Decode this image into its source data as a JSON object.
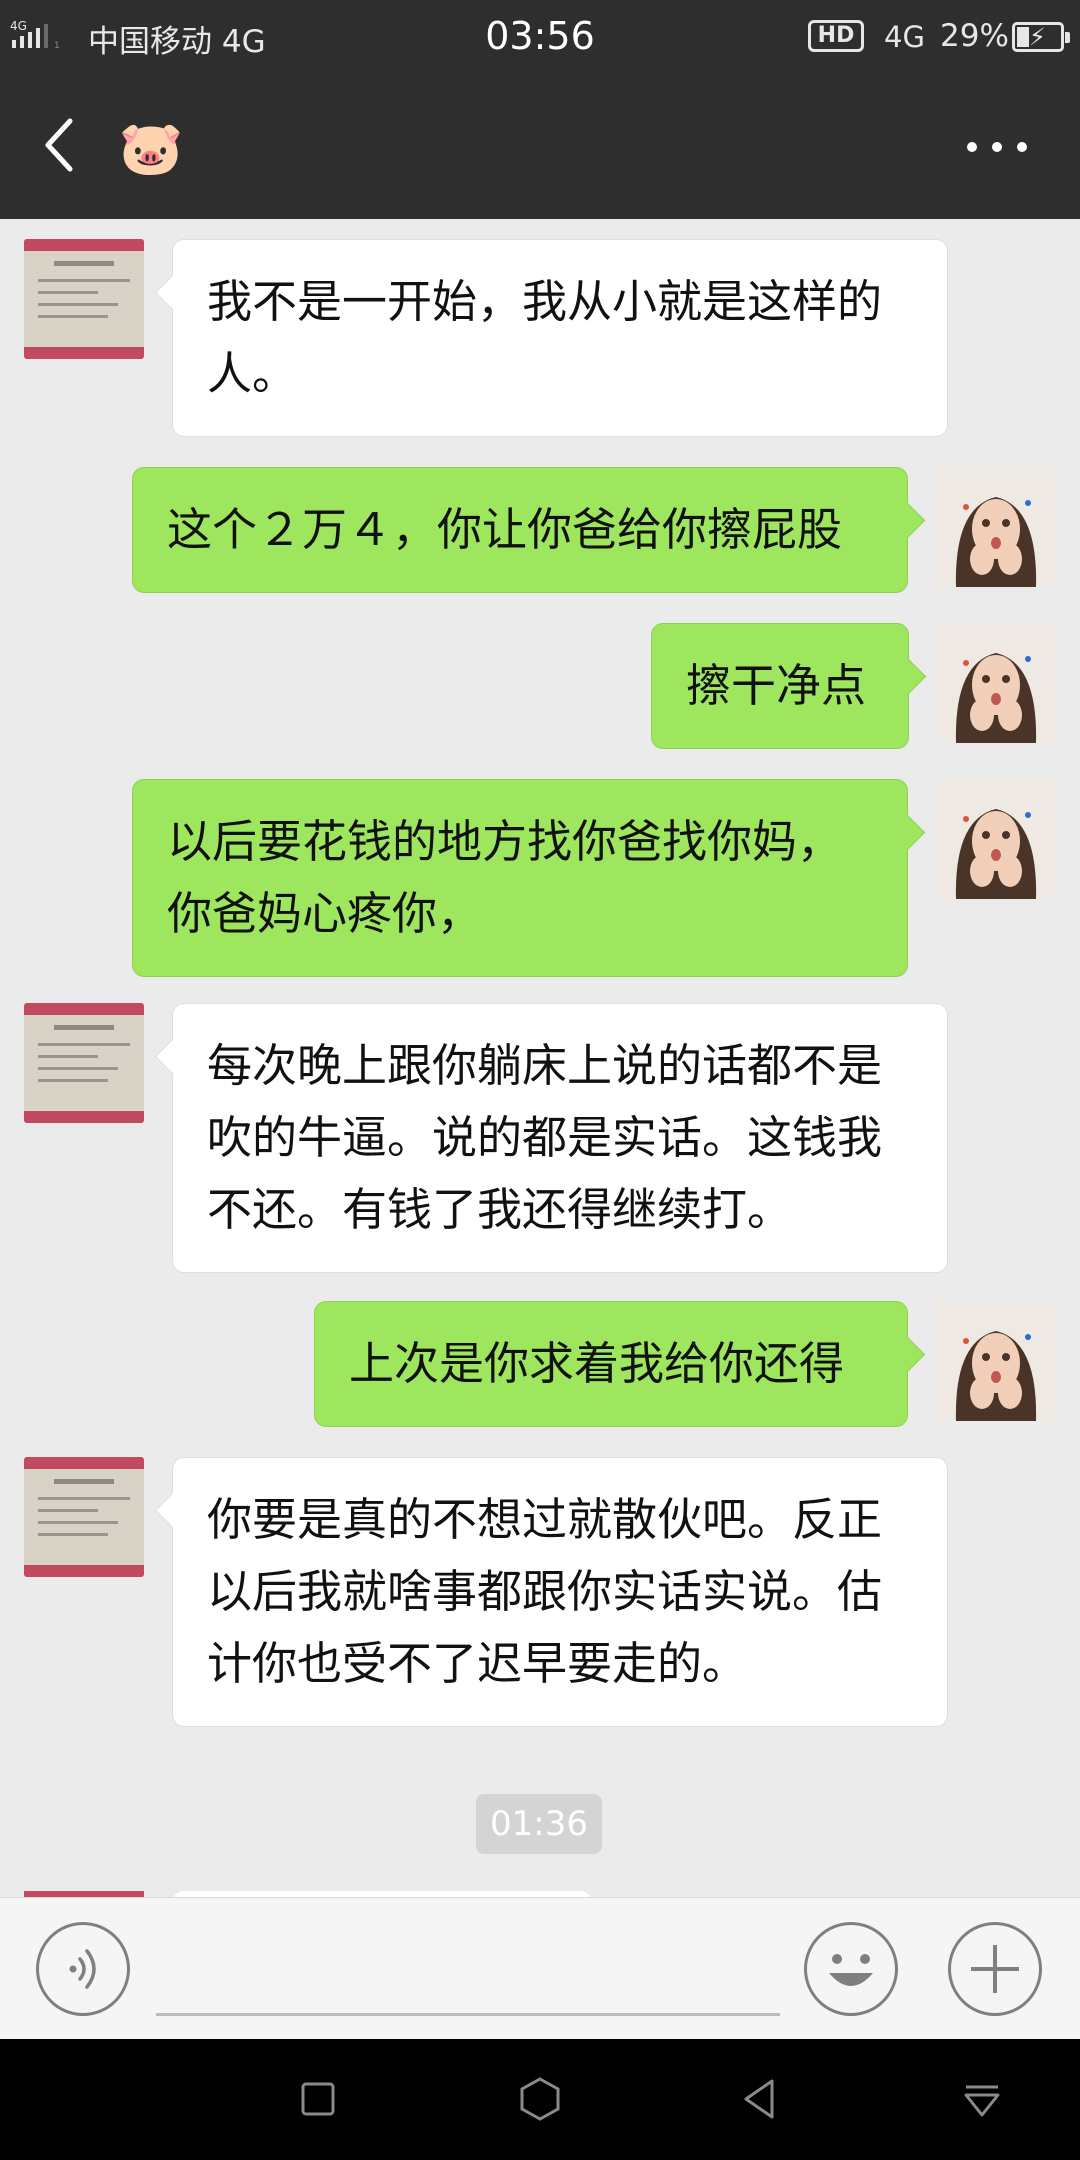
{
  "status_bar": {
    "network_small": "4G",
    "carrier": "中国移动 4G",
    "time": "03:56",
    "hd": "HD",
    "network": "4G",
    "battery": "29%",
    "battery_level": 0.29
  },
  "header": {
    "title_emoji": "🐷",
    "back_icon": "chevron-left-icon",
    "more_icon": "more-horizontal-icon"
  },
  "messages": [
    {
      "side": "in",
      "text": "我不是一开始，我从小就是这样的人。"
    },
    {
      "side": "out",
      "text": "这个２万４，你让你爸给你擦屁股"
    },
    {
      "side": "out",
      "text": "擦干净点"
    },
    {
      "side": "out",
      "text": "以后要花钱的地方找你爸找你妈，你爸妈心疼你，"
    },
    {
      "side": "in",
      "text": "每次晚上跟你躺床上说的话都不是吹的牛逼。说的都是实话。这钱我不还。有钱了我还得继续打。"
    },
    {
      "side": "out",
      "text": "上次是你求着我给你还得"
    },
    {
      "side": "in",
      "text": "你要是真的不想过就散伙吧。反正以后我就啥事都跟你实话实说。估计你也受不了迟早要走的。"
    }
  ],
  "timestamp": "01:36",
  "input_bar": {
    "voice_icon": "voice-icon",
    "emoji_icon": "smiley-icon",
    "plus_icon": "plus-icon"
  },
  "nav_bar": {
    "recent_icon": "square-icon",
    "home_icon": "hexagon-icon",
    "back_icon": "triangle-back-icon",
    "notify_icon": "pull-down-icon"
  },
  "colors": {
    "header": "#2e2e2e",
    "chat_bg": "#ebebeb",
    "out_bubble": "#9ee65d",
    "in_bubble": "#ffffff"
  }
}
